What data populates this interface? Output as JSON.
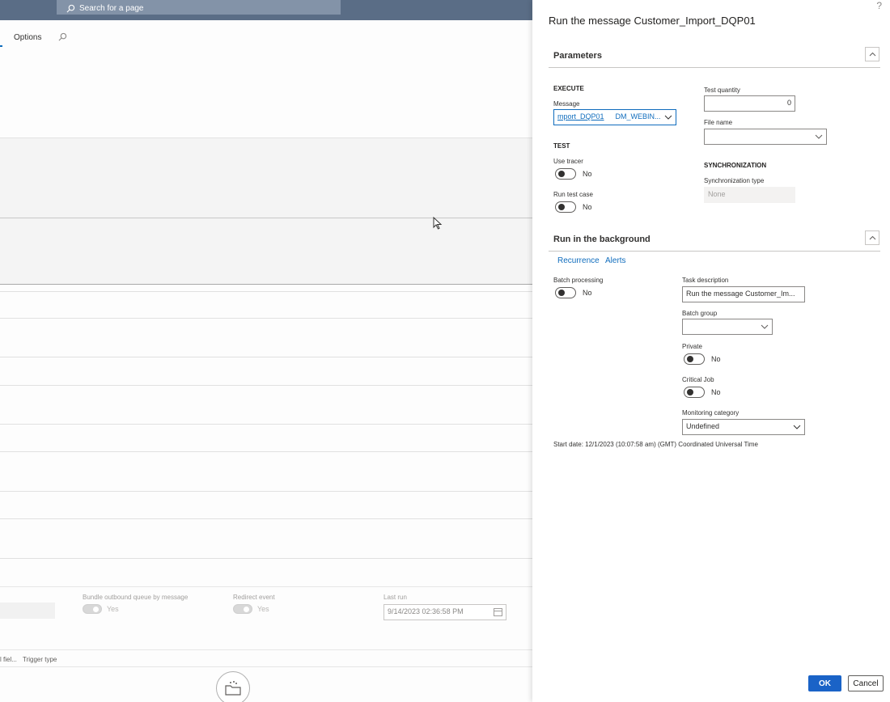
{
  "background": {
    "search": {
      "placeholder": "Search for a page"
    },
    "action_tabs": {
      "options_label": "Options"
    },
    "bottom_form": {
      "bundle_label": "Bundle outbound queue by message",
      "bundle_value": "Yes",
      "redirect_label": "Redirect event",
      "redirect_value": "Yes",
      "last_run_label": "Last run",
      "last_run_value": "9/14/2023 02:36:58 PM"
    },
    "footer_tabs": [
      "l fiel...",
      "Trigger type"
    ]
  },
  "dialog": {
    "help": "?",
    "title": "Run the message Customer_Import_DQP01",
    "parameters": {
      "header": "Parameters",
      "execute_group": "EXECUTE",
      "message_label": "Message",
      "message_value": "mport_DQP01",
      "message_value2": "DM_WEBIN...",
      "test_group": "TEST",
      "use_tracer_label": "Use tracer",
      "use_tracer_value": "No",
      "run_test_case_label": "Run test case",
      "run_test_case_value": "No",
      "test_quantity_label": "Test quantity",
      "test_quantity_value": "0",
      "file_name_label": "File name",
      "file_name_value": "",
      "sync_group": "SYNCHRONIZATION",
      "sync_type_label": "Synchronization type",
      "sync_type_value": "None"
    },
    "background_run": {
      "header": "Run in the background",
      "tabs": [
        "Recurrence",
        "Alerts"
      ],
      "batch_processing_label": "Batch processing",
      "batch_processing_value": "No",
      "task_description_label": "Task description",
      "task_description_value": "Run the message Customer_Im...",
      "batch_group_label": "Batch group",
      "batch_group_value": "",
      "private_label": "Private",
      "private_value": "No",
      "critical_job_label": "Critical Job",
      "critical_job_value": "No",
      "monitoring_category_label": "Monitoring category",
      "monitoring_category_value": "Undefined",
      "start_date_text": "Start date: 12/1/2023 (10:07:58 am) (GMT) Coordinated Universal Time"
    },
    "buttons": {
      "ok": "OK",
      "cancel": "Cancel"
    }
  },
  "colors": {
    "accent": "#0f6cbd",
    "primary_button": "#1a63c7",
    "topbar": "#5a6d86"
  }
}
